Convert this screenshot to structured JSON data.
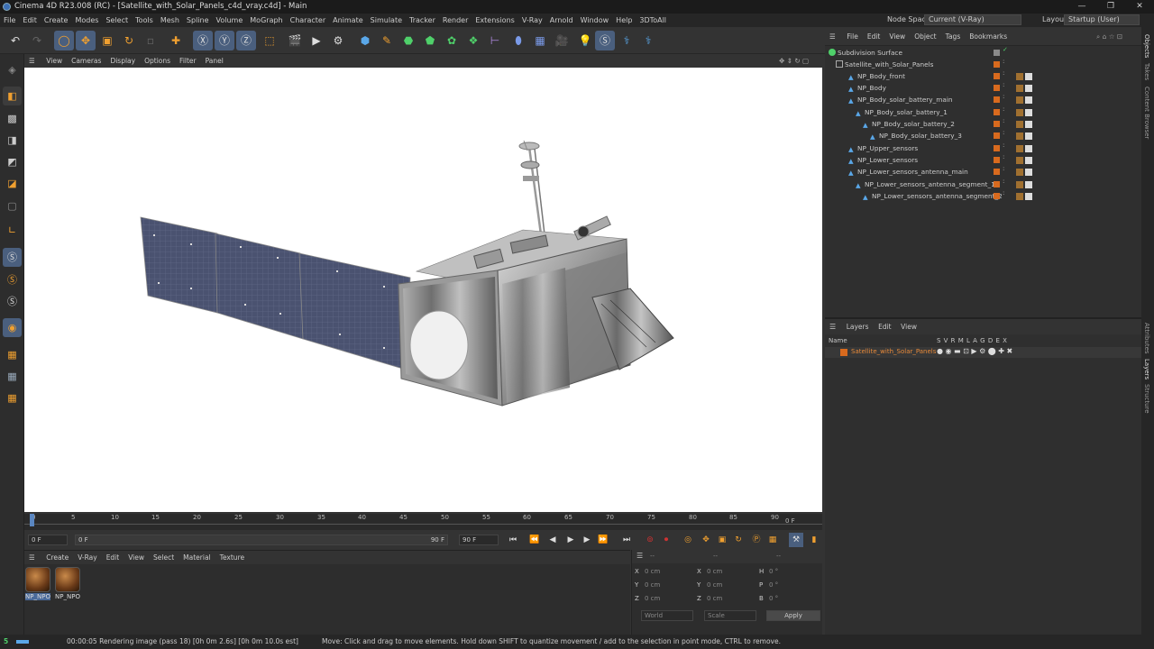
{
  "window": {
    "title": "Cinema 4D R23.008 (RC) - [Satellite_with_Solar_Panels_c4d_vray.c4d] - Main",
    "minimize": "—",
    "maximize": "❐",
    "close": "✕"
  },
  "menu": [
    "File",
    "Edit",
    "Create",
    "Modes",
    "Select",
    "Tools",
    "Mesh",
    "Spline",
    "Volume",
    "MoGraph",
    "Character",
    "Animate",
    "Simulate",
    "Tracker",
    "Render",
    "Extensions",
    "V-Ray",
    "Arnold",
    "Window",
    "Help",
    "3DToAll"
  ],
  "nodespace": {
    "label": "Node Space:",
    "value": "Current (V-Ray)"
  },
  "layout": {
    "label": "Layout:",
    "value": "Startup (User)"
  },
  "viewport_menu": [
    "View",
    "Cameras",
    "Display",
    "Options",
    "Filter",
    "Panel"
  ],
  "objects_menu": [
    "File",
    "Edit",
    "View",
    "Object",
    "Tags",
    "Bookmarks"
  ],
  "objects": [
    {
      "name": "Subdivision Surface",
      "indent": 0
    },
    {
      "name": "Satellite_with_Solar_Panels",
      "indent": 1
    },
    {
      "name": "NP_Body_front",
      "indent": 2
    },
    {
      "name": "NP_Body",
      "indent": 2
    },
    {
      "name": "NP_Body_solar_battery_main",
      "indent": 2
    },
    {
      "name": "NP_Body_solar_battery_1",
      "indent": 3
    },
    {
      "name": "NP_Body_solar_battery_2",
      "indent": 4
    },
    {
      "name": "NP_Body_solar_battery_3",
      "indent": 5
    },
    {
      "name": "NP_Upper_sensors",
      "indent": 2
    },
    {
      "name": "NP_Lower_sensors",
      "indent": 2
    },
    {
      "name": "NP_Lower_sensors_antenna_main",
      "indent": 2
    },
    {
      "name": "NP_Lower_sensors_antenna_segment_1",
      "indent": 3
    },
    {
      "name": "NP_Lower_sensors_antenna_segment_2",
      "indent": 4
    }
  ],
  "layers": {
    "menu": [
      "Layers",
      "Edit",
      "View"
    ],
    "col_name": "Name",
    "cols": "S V R M L A G D E X",
    "items": [
      "Satellite_with_Solar_Panels"
    ]
  },
  "timeline": {
    "ticks": [
      "0",
      "5",
      "10",
      "15",
      "20",
      "25",
      "30",
      "35",
      "40",
      "45",
      "50",
      "55",
      "60",
      "65",
      "70",
      "75",
      "80",
      "85",
      "90"
    ],
    "current": "0 F"
  },
  "playback": {
    "start": "0 F",
    "range_start": "0 F",
    "range_end": "90 F",
    "end": "90 F"
  },
  "material": {
    "menu": [
      "Create",
      "V-Ray",
      "Edit",
      "View",
      "Select",
      "Material",
      "Texture"
    ],
    "items": [
      "NP_NPO",
      "NP_NPO"
    ]
  },
  "coords": {
    "header": [
      "--",
      "--",
      "--"
    ],
    "rows": [
      {
        "a": "X",
        "av": "0 cm",
        "b": "X",
        "bv": "0 cm",
        "c": "H",
        "cv": "0 °"
      },
      {
        "a": "Y",
        "av": "0 cm",
        "b": "Y",
        "bv": "0 cm",
        "c": "P",
        "cv": "0 °"
      },
      {
        "a": "Z",
        "av": "0 cm",
        "b": "Z",
        "bv": "0 cm",
        "c": "B",
        "cv": "0 °"
      }
    ],
    "world": "World",
    "scale": "Scale",
    "apply": "Apply"
  },
  "status": {
    "render": "00:00:05 Rendering image (pass 18) [0h  0m  2.6s] [0h  0m 10.0s est]",
    "hint": "Move: Click and drag to move elements. Hold down SHIFT to quantize movement / add to the selection in point mode, CTRL to remove."
  },
  "sidetabs": [
    "Objects",
    "Takes",
    "Content Browser",
    "Attributes",
    "Layers",
    "Structure"
  ]
}
